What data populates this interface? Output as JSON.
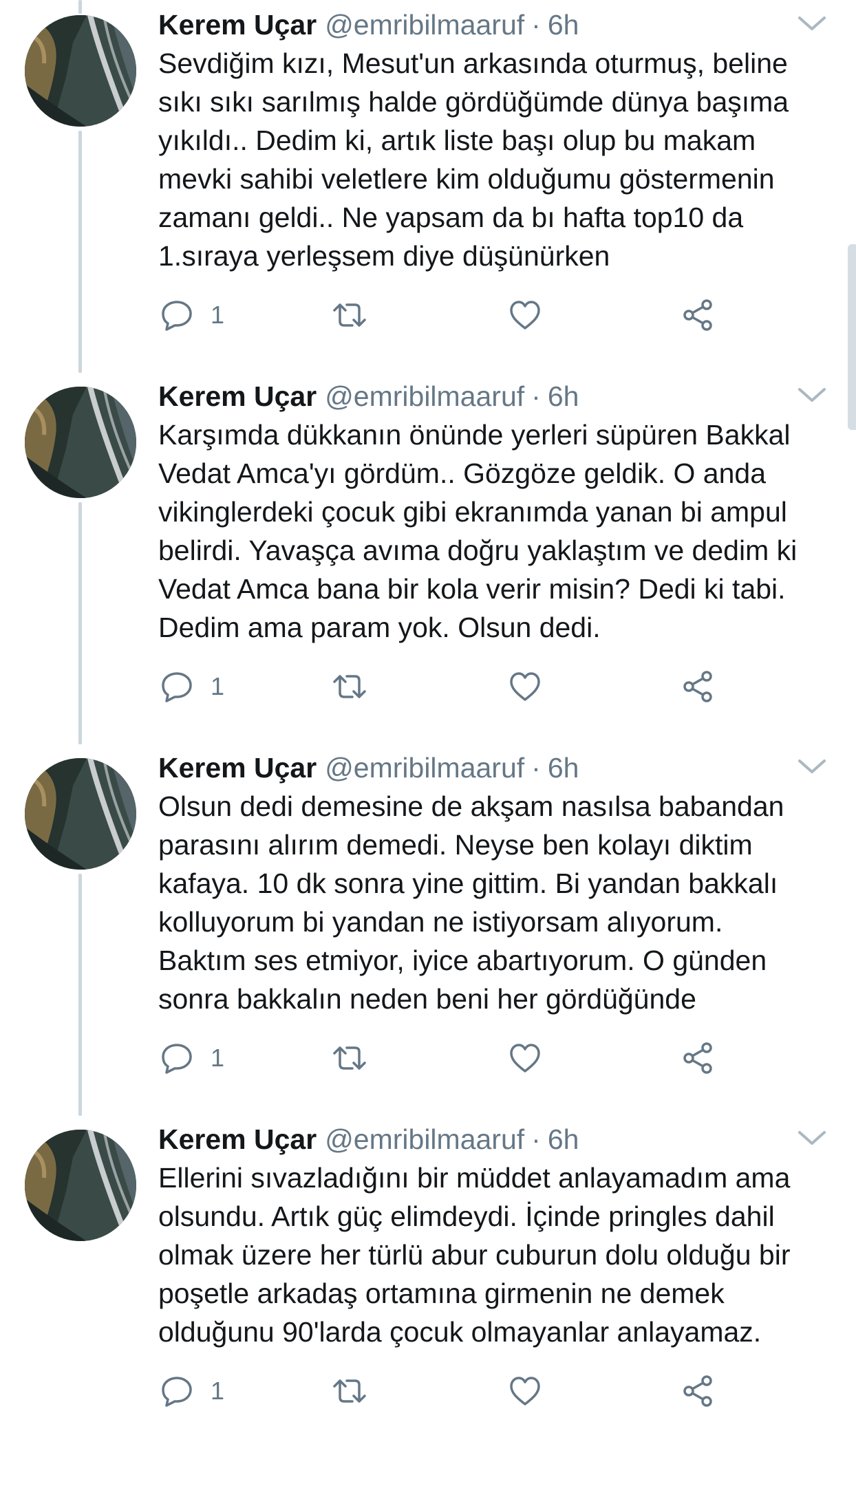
{
  "tweets": [
    {
      "name": "Kerem Uçar",
      "handle": "@emribilmaaruf",
      "dot": "·",
      "time": "6h",
      "lines": [
        "Sevdiğim kızı, Mesut'un arkasında oturmuş, beline",
        "sıkı sıkı sarılmış halde gördüğümde dünya başıma",
        "yıkıldı.. Dedim ki, artık liste başı olup bu makam",
        "mevki sahibi veletlere kim olduğumu göstermenin",
        "zamanı geldi.. Ne yapsam da bı hafta top10 da",
        "1.sıraya yerleşsem diye düşünürken"
      ],
      "reply_count": "1"
    },
    {
      "name": "Kerem Uçar",
      "handle": "@emribilmaaruf",
      "dot": "·",
      "time": "6h",
      "lines": [
        "Karşımda dükkanın önünde yerleri süpüren Bakkal",
        "Vedat Amca'yı gördüm.. Gözgöze geldik. O anda",
        "vikinglerdeki çocuk gibi ekranımda yanan bi ampul",
        "belirdi. Yavaşça avıma doğru yaklaştım ve dedim ki",
        "Vedat Amca bana bir kola verir misin? Dedi ki tabi.",
        "Dedim ama param yok. Olsun dedi."
      ],
      "reply_count": "1"
    },
    {
      "name": "Kerem Uçar",
      "handle": "@emribilmaaruf",
      "dot": "·",
      "time": "6h",
      "lines": [
        "Olsun dedi demesine de akşam nasılsa babandan",
        "parasını alırım demedi. Neyse ben kolayı diktim",
        "kafaya. 10 dk sonra yine gittim. Bi yandan bakkalı",
        "kolluyorum bi yandan ne istiyorsam alıyorum.",
        "Baktım ses etmiyor, iyice abartıyorum. O günden",
        "sonra bakkalın neden beni her gördüğünde"
      ],
      "reply_count": "1"
    },
    {
      "name": "Kerem Uçar",
      "handle": "@emribilmaaruf",
      "dot": "·",
      "time": "6h",
      "lines": [
        "Ellerini sıvazladığını bir müddet anlayamadım ama",
        "olsundu. Artık güç elimdeydi. İçinde pringles dahil",
        "olmak üzere her türlü abur cuburun dolu olduğu bir",
        "poşetle arkadaş ortamına girmenin ne demek",
        "olduğunu 90'larda çocuk olmayanlar anlayamaz."
      ],
      "reply_count": "1"
    }
  ],
  "icons": {
    "reply": "reply-icon",
    "retweet": "retweet-icon",
    "like": "heart-icon",
    "share": "share-icon",
    "caret": "chevron-down-icon"
  },
  "colors": {
    "text": "#14171a",
    "secondary": "#657786",
    "thread_line": "#ccd6dd"
  }
}
